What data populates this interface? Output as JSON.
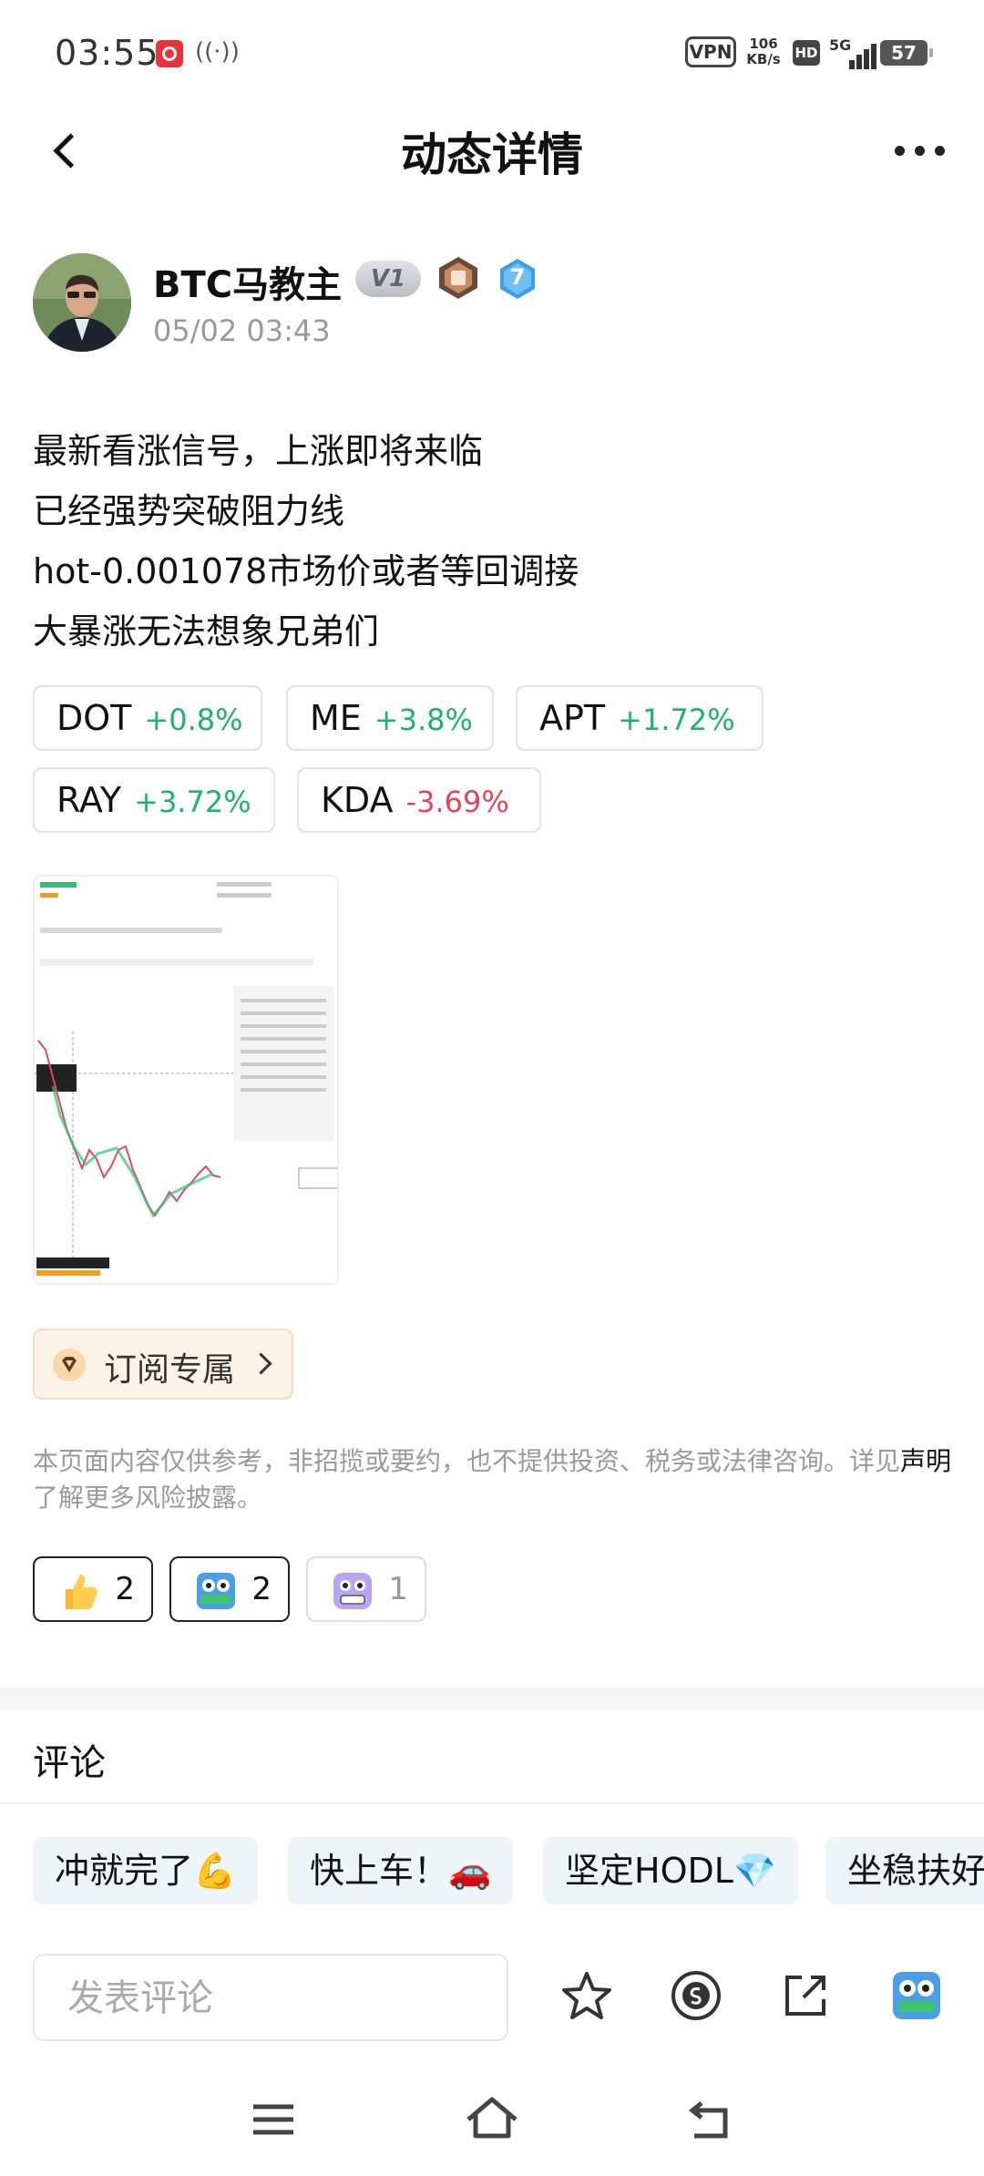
{
  "status_bar": {
    "time": "03:55",
    "vpn": "VPN",
    "speed_value": "106",
    "speed_unit": "KB/s",
    "hd": "HD",
    "network": "5G",
    "battery": "57"
  },
  "nav": {
    "title": "动态详情"
  },
  "author": {
    "name": "BTC马教主",
    "badge": "V1",
    "level": "7",
    "time": "05/02 03:43"
  },
  "post": {
    "lines": [
      "最新看涨信号，上涨即将来临",
      "已经强势突破阻力线",
      "hot-0.001078市场价或者等回调接",
      "大暴涨无法想象兄弟们"
    ]
  },
  "tickers": [
    {
      "symbol": "DOT",
      "change": "+0.8%",
      "direction": "up"
    },
    {
      "symbol": "ME",
      "change": "+3.8%",
      "direction": "up"
    },
    {
      "symbol": "APT",
      "change": "+1.72%",
      "direction": "up"
    },
    {
      "symbol": "RAY",
      "change": "+3.72%",
      "direction": "up"
    },
    {
      "symbol": "KDA",
      "change": "-3.69%",
      "direction": "down"
    }
  ],
  "subscribe": {
    "label": "订阅专属"
  },
  "disclaimer": {
    "text_before": "本页面内容仅供参考，非招揽或要约，也不提供投资、税务或法律咨询。详见",
    "link": "声明",
    "text_after": "了解更多风险披露。"
  },
  "reactions": [
    {
      "icon": "thumbs-up-icon",
      "count": "2"
    },
    {
      "icon": "hodl-icon",
      "count": "2"
    },
    {
      "icon": "grimace-icon",
      "count": "1"
    }
  ],
  "comments": {
    "title": "评论",
    "quick": [
      "冲就完了💪",
      "快上车！🚗",
      "坚定HODL💎",
      "坐稳扶好"
    ],
    "input_placeholder": "发表评论"
  },
  "colors": {
    "up": "#20b26c",
    "down": "#e0465b",
    "subscribe_bg": "#fdf3e7",
    "quick_bg": "#eef5f9"
  }
}
